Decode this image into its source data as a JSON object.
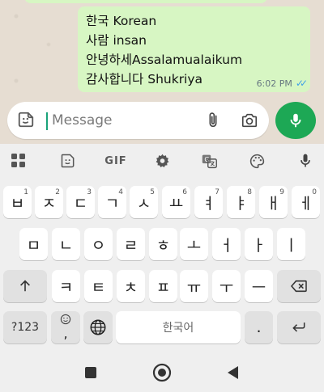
{
  "chat": {
    "message_lines": [
      "한국 Korean",
      "사람 insan",
      "안녕하세Assalamualaikum",
      "감사합니다 Shukriya"
    ],
    "time": "6:02 PM",
    "status": "read"
  },
  "composer": {
    "placeholder": "Message"
  },
  "keyboard": {
    "toolbar": {
      "gif_label": "GIF"
    },
    "row1": [
      {
        "char": "ㅂ",
        "hint": "1"
      },
      {
        "char": "ㅈ",
        "hint": "2"
      },
      {
        "char": "ㄷ",
        "hint": "3"
      },
      {
        "char": "ㄱ",
        "hint": "4"
      },
      {
        "char": "ㅅ",
        "hint": "5"
      },
      {
        "char": "ㅛ",
        "hint": "6"
      },
      {
        "char": "ㅕ",
        "hint": "7"
      },
      {
        "char": "ㅑ",
        "hint": "8"
      },
      {
        "char": "ㅐ",
        "hint": "9"
      },
      {
        "char": "ㅔ",
        "hint": "0"
      }
    ],
    "row2": [
      "ㅁ",
      "ㄴ",
      "ㅇ",
      "ㄹ",
      "ㅎ",
      "ㅗ",
      "ㅓ",
      "ㅏ",
      "ㅣ"
    ],
    "row3": [
      "ㅋ",
      "ㅌ",
      "ㅊ",
      "ㅍ",
      "ㅠ",
      "ㅜ",
      "ㅡ"
    ],
    "bottom": {
      "symbols_label": "?123",
      "comma_label": ",",
      "space_label": "한국어",
      "period_label": "."
    }
  },
  "colors": {
    "bubble": "#d7f6c3",
    "accent": "#1da855",
    "read_ticks": "#3fa0e8"
  }
}
